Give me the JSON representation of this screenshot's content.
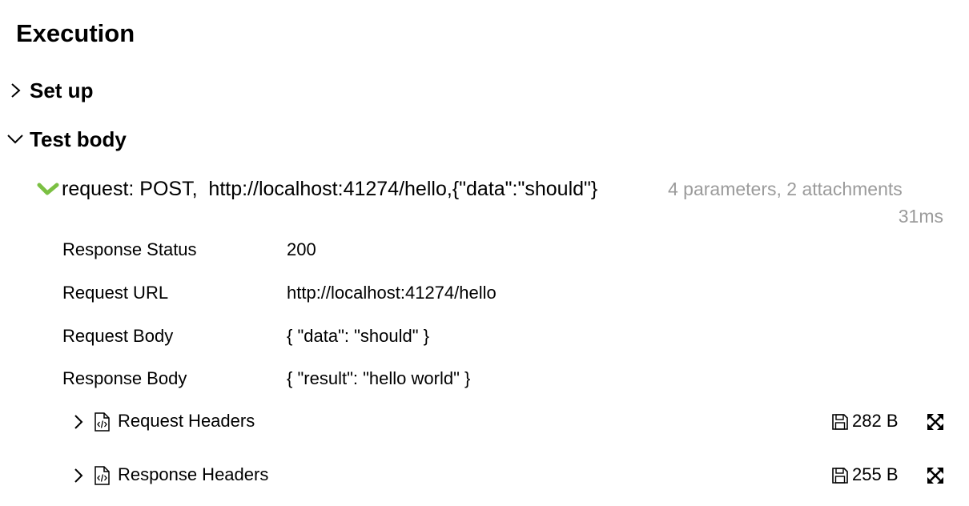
{
  "execution": {
    "title": "Execution"
  },
  "sections": {
    "setup": {
      "label": "Set up",
      "expanded": false,
      "icon": "chevron-right-icon"
    },
    "test_body": {
      "label": "Test body",
      "expanded": true,
      "icon": "chevron-down-icon"
    }
  },
  "step": {
    "status_icon": "check-icon",
    "status_color": "#7bc043",
    "name": "request: POST,  http://localhost:41274/hello,{\"data\":\"should\"}",
    "meta": "4 parameters, 2 attachments",
    "duration": "31ms",
    "parameters": [
      {
        "name": "Response Status",
        "value": "200"
      },
      {
        "name": "Request URL",
        "value": "http://localhost:41274/hello"
      },
      {
        "name": "Request Body",
        "value": "{ \"data\": \"should\" }"
      },
      {
        "name": "Response Body",
        "value": "{ \"result\": \"hello world\" }"
      }
    ],
    "attachments": [
      {
        "name": "Request Headers",
        "size": "282 B",
        "icons": [
          "chevron-right-icon",
          "code-file-icon",
          "save-icon",
          "expand-icon"
        ]
      },
      {
        "name": "Response Headers",
        "size": "255 B",
        "icons": [
          "chevron-right-icon",
          "code-file-icon",
          "save-icon",
          "expand-icon"
        ]
      }
    ]
  },
  "colors": {
    "text": "#000000",
    "muted": "#9b9b9b",
    "success": "#7bc043"
  }
}
